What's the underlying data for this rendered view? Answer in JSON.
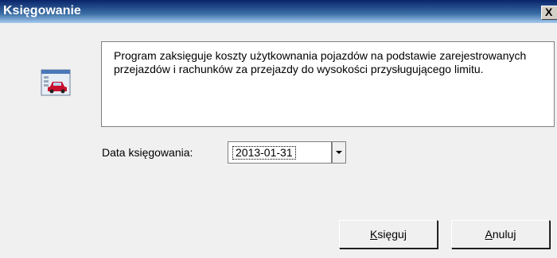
{
  "window": {
    "title": "Księgowanie",
    "close_label": "X"
  },
  "icon": "calculator-car-icon",
  "description": "Program zaksięguje koszty użytkownania pojazdów na podstawie zarejestrowanych przejazdów i rachunków za przejazdy do wysokości przysługującego limitu.",
  "form": {
    "date_label": "Data księgowania:",
    "date_value": "2013-01-31"
  },
  "buttons": {
    "ok_mnemonic": "K",
    "ok_rest": "sięguj",
    "cancel_mnemonic": "A",
    "cancel_rest": "nuluj"
  },
  "colors": {
    "titlebar_start": "#0a246a",
    "titlebar_end": "#a6caf0",
    "dialog_bg": "#f0f0f0"
  }
}
